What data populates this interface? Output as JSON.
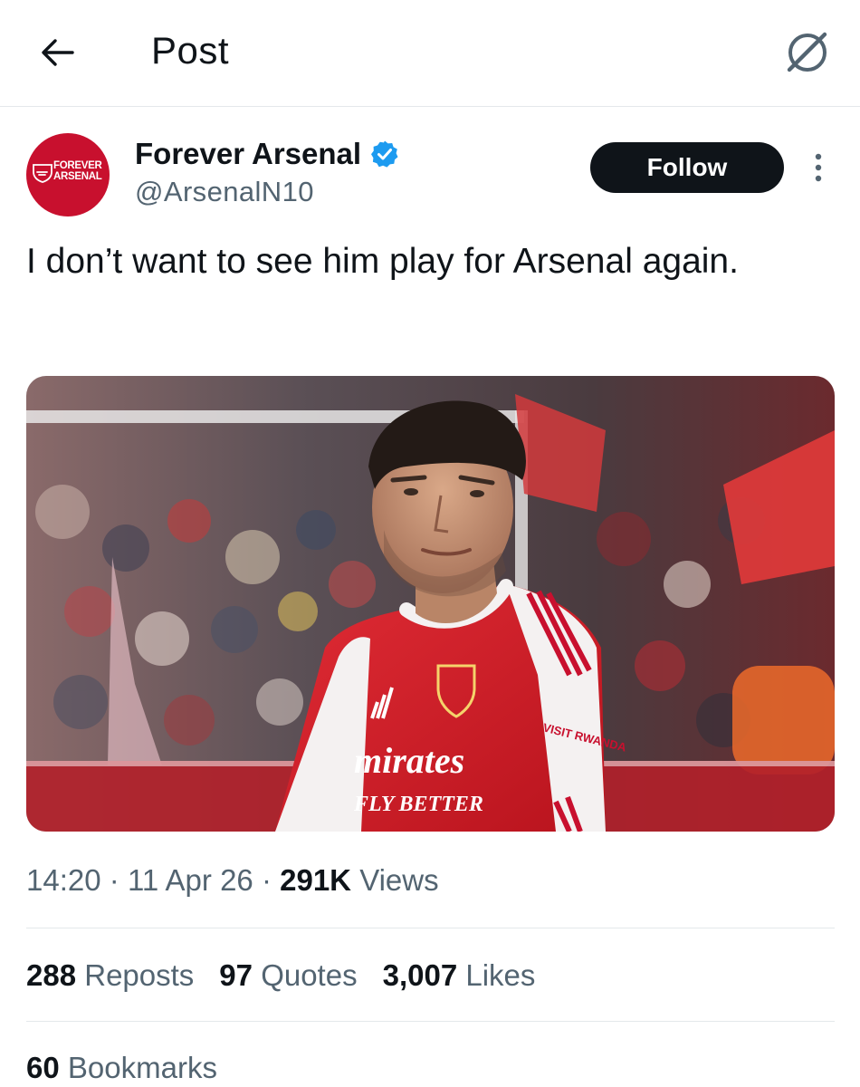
{
  "header": {
    "title": "Post",
    "back_icon": "arrow-left-icon",
    "grok_icon": "grok-icon"
  },
  "author": {
    "display_name": "Forever Arsenal",
    "handle": "@ArsenalN10",
    "verified": true,
    "avatar_text_line1": "FOREVER",
    "avatar_text_line2": "ARSENAL",
    "avatar_color": "#c8102e",
    "follow_label": "Follow"
  },
  "tweet": {
    "text": "I don’t want to see him play for Arsenal again.",
    "media_alt": "Arsenal player in red and white home kit in front of a stadium crowd",
    "kit_sponsor_line1": "mirates",
    "kit_sponsor_line2": "FLY BETTER",
    "sleeve_sponsor": "VISIT RWANDA"
  },
  "meta": {
    "time": "14:20",
    "date": "11 Apr 26",
    "views_count": "291K",
    "views_label": "Views",
    "separator": "·"
  },
  "stats": {
    "reposts_count": "288",
    "reposts_label": "Reposts",
    "quotes_count": "97",
    "quotes_label": "Quotes",
    "likes_count": "3,007",
    "likes_label": "Likes",
    "bookmarks_count": "60",
    "bookmarks_label": "Bookmarks"
  },
  "colors": {
    "text_primary": "#0f1419",
    "text_secondary": "#536471",
    "verified_blue": "#1d9bf0",
    "divider": "#e4e8eb",
    "arsenal_red": "#c8102e"
  }
}
